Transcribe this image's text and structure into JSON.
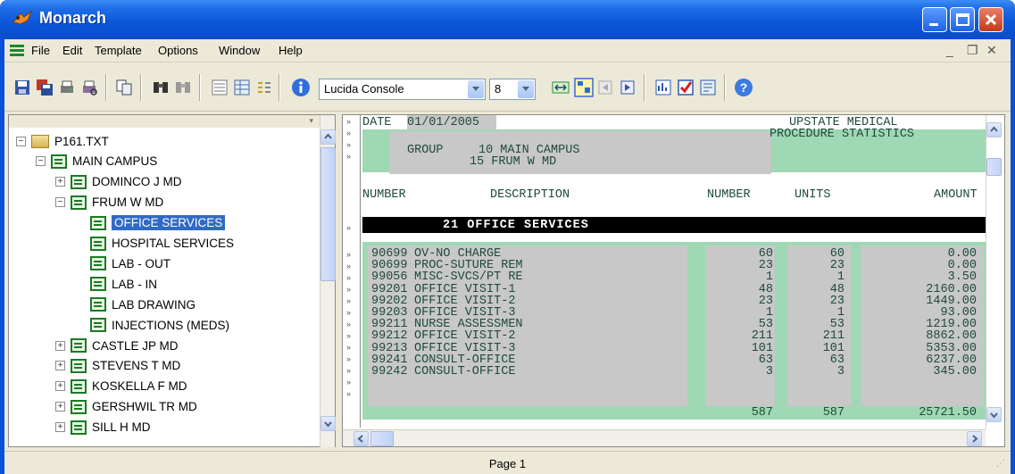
{
  "window": {
    "title": "Monarch"
  },
  "menu": [
    "File",
    "Edit",
    "Template",
    "Options",
    "Window",
    "Help"
  ],
  "toolbar": {
    "font_name": "Lucida Console",
    "font_size": "8"
  },
  "tree": [
    {
      "label": "P161.TXT",
      "level": 0,
      "exp": "−",
      "icon": "folder-icon"
    },
    {
      "label": "MAIN CAMPUS",
      "level": 1,
      "exp": "−",
      "icon": "doc-icon"
    },
    {
      "label": "DOMINCO J MD",
      "level": 2,
      "exp": "+",
      "icon": "doc-icon"
    },
    {
      "label": "FRUM W MD",
      "level": 2,
      "exp": "−",
      "icon": "doc-icon"
    },
    {
      "label": "OFFICE SERVICES",
      "level": 3,
      "exp": "",
      "icon": "doc-icon",
      "selected": true
    },
    {
      "label": "HOSPITAL SERVICES",
      "level": 3,
      "exp": "",
      "icon": "doc-icon"
    },
    {
      "label": "LAB - OUT",
      "level": 3,
      "exp": "",
      "icon": "doc-icon"
    },
    {
      "label": "LAB - IN",
      "level": 3,
      "exp": "",
      "icon": "doc-icon"
    },
    {
      "label": "LAB DRAWING",
      "level": 3,
      "exp": "",
      "icon": "doc-icon"
    },
    {
      "label": "INJECTIONS (MEDS)",
      "level": 3,
      "exp": "",
      "icon": "doc-icon"
    },
    {
      "label": "CASTLE JP MD",
      "level": 2,
      "exp": "+",
      "icon": "doc-icon"
    },
    {
      "label": "STEVENS T MD",
      "level": 2,
      "exp": "+",
      "icon": "doc-icon"
    },
    {
      "label": "KOSKELLA F MD",
      "level": 2,
      "exp": "+",
      "icon": "doc-icon"
    },
    {
      "label": "GERSHWIL TR MD",
      "level": 2,
      "exp": "+",
      "icon": "doc-icon"
    },
    {
      "label": "SILL H MD",
      "level": 2,
      "exp": "+",
      "icon": "doc-icon"
    }
  ],
  "report": {
    "date_label": "DATE",
    "date_value": "01/01/2005",
    "org": "UPSTATE MEDICAL",
    "subtitle": "PROCEDURE STATISTICS",
    "group_label": "GROUP",
    "group_value": "10 MAIN CAMPUS",
    "doctor": "15 FRUM W MD",
    "col_number": "NUMBER",
    "col_description": "DESCRIPTION",
    "col_number2": "NUMBER",
    "col_units": "UNITS",
    "col_amount": "AMOUNT",
    "section": "21 OFFICE SERVICES",
    "rows": [
      {
        "code": "90699",
        "desc": "OV-NO CHARGE",
        "num": "60",
        "units": "60",
        "amount": "0.00"
      },
      {
        "code": "90699",
        "desc": "PROC-SUTURE REM",
        "num": "23",
        "units": "23",
        "amount": "0.00"
      },
      {
        "code": "99056",
        "desc": "MISC-SVCS/PT RE",
        "num": "1",
        "units": "1",
        "amount": "3.50"
      },
      {
        "code": "99201",
        "desc": "OFFICE VISIT-1",
        "num": "48",
        "units": "48",
        "amount": "2160.00"
      },
      {
        "code": "99202",
        "desc": "OFFICE VISIT-2",
        "num": "23",
        "units": "23",
        "amount": "1449.00"
      },
      {
        "code": "99203",
        "desc": "OFFICE VISIT-3",
        "num": "1",
        "units": "1",
        "amount": "93.00"
      },
      {
        "code": "99211",
        "desc": "NURSE ASSESSMEN",
        "num": "53",
        "units": "53",
        "amount": "1219.00"
      },
      {
        "code": "99212",
        "desc": "OFFICE VISIT-2",
        "num": "211",
        "units": "211",
        "amount": "8862.00"
      },
      {
        "code": "99213",
        "desc": "OFFICE VISIT-3",
        "num": "101",
        "units": "101",
        "amount": "5353.00"
      },
      {
        "code": "99241",
        "desc": "CONSULT-OFFICE",
        "num": "63",
        "units": "63",
        "amount": "6237.00"
      },
      {
        "code": "99242",
        "desc": "CONSULT-OFFICE",
        "num": "3",
        "units": "3",
        "amount": "345.00"
      }
    ],
    "total_num": "587",
    "total_units": "587",
    "total_amount": "25721.50"
  },
  "status": {
    "page": "Page 1"
  }
}
